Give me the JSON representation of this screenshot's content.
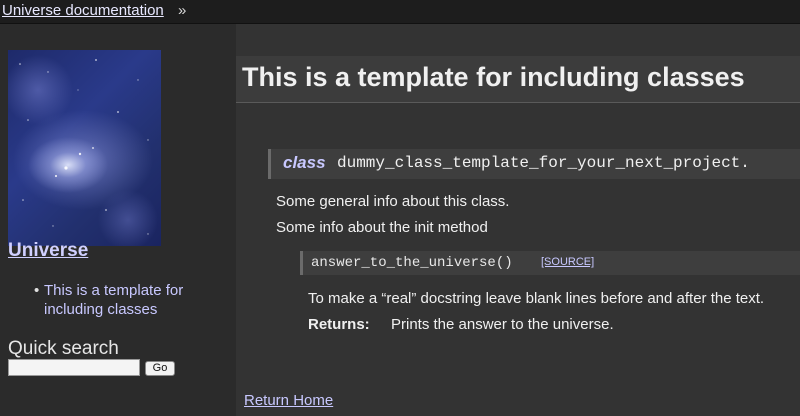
{
  "topbar": {
    "breadcrumb": "Universe documentation",
    "separator": "»"
  },
  "sidebar": {
    "logo_icon": "galaxy-image",
    "project_link": "Universe",
    "toc_bullet": "•",
    "toc_items": [
      {
        "label": "This is a template for including classes"
      }
    ],
    "quick_search": {
      "title": "Quick search",
      "value": "",
      "go_label": "Go"
    }
  },
  "content": {
    "title": "This is a template for including classes",
    "class_keyword": "class",
    "class_name": "dummy_class_template_for_your_next_project.",
    "paragraphs": [
      "Some general info about this class.",
      "Some info about the init method"
    ],
    "method": {
      "signature": "answer_to_the_universe()",
      "source_label": "[SOURCE]",
      "description": "To make a “real” docstring leave blank lines before and after the text.",
      "returns_label": "Returns:",
      "returns_text": "Prints the answer to the universe."
    },
    "footer_link": "Return Home"
  }
}
